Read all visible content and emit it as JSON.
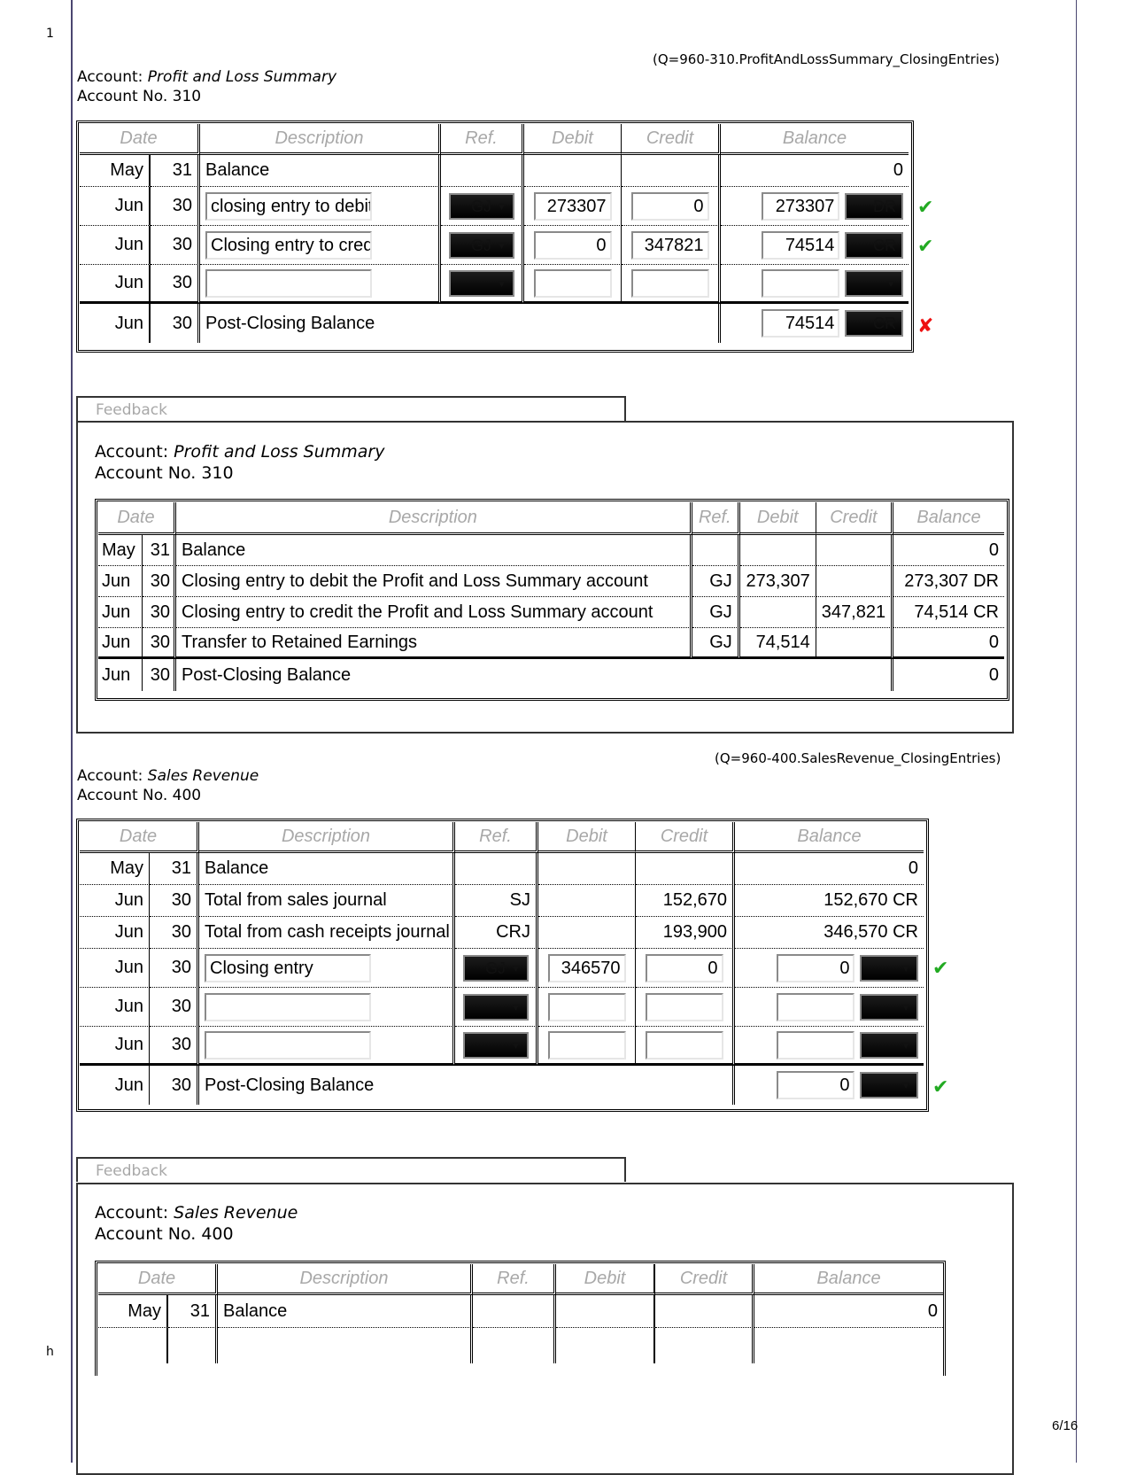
{
  "margin": {
    "line_number": "1",
    "footer_left": "h",
    "page_no": "6/16"
  },
  "pl": {
    "question_id": "(Q=960-310.ProfitAndLossSummary_ClosingEntries)",
    "account_label": "Account: ",
    "account_name": "Profit and Loss Summary",
    "account_no": "Account No. 310",
    "headers": {
      "date": "Date",
      "description": "Description",
      "ref": "Ref.",
      "debit": "Debit",
      "credit": "Credit",
      "balance": "Balance"
    },
    "opening": {
      "month": "May",
      "day": "31",
      "description": "Balance",
      "balance": "0"
    },
    "entries": [
      {
        "month": "Jun",
        "day": "30",
        "description": "closing entry to debit",
        "ref": "GJ",
        "debit": "273307",
        "credit": "0",
        "balance": "273307",
        "side": "DR",
        "result": "correct"
      },
      {
        "month": "Jun",
        "day": "30",
        "description": "Closing entry to credi",
        "ref": "GJ",
        "debit": "0",
        "credit": "347821",
        "balance": "74514",
        "side": "CR",
        "result": "correct"
      },
      {
        "month": "Jun",
        "day": "30",
        "description": "",
        "ref": "",
        "debit": "",
        "credit": "",
        "balance": "",
        "side": "",
        "result": ""
      }
    ],
    "post_closing": {
      "month": "Jun",
      "day": "30",
      "description": "Post-Closing Balance",
      "balance": "74514",
      "side": "CR",
      "result": "incorrect"
    }
  },
  "pl_feedback": {
    "tab_label": "Feedback",
    "account_label": "Account: ",
    "account_name": "Profit and Loss Summary",
    "account_no": "Account No. 310",
    "headers": {
      "date": "Date",
      "description": "Description",
      "ref": "Ref.",
      "debit": "Debit",
      "credit": "Credit",
      "balance": "Balance"
    },
    "rows": [
      {
        "month": "May",
        "day": "31",
        "description": "Balance",
        "ref": "",
        "debit": "",
        "credit": "",
        "balance": "0"
      },
      {
        "month": "Jun",
        "day": "30",
        "description": "Closing entry to debit the Profit and Loss Summary account",
        "ref": "GJ",
        "debit": "273,307",
        "credit": "",
        "balance": "273,307 DR"
      },
      {
        "month": "Jun",
        "day": "30",
        "description": "Closing entry to credit the Profit and Loss Summary account",
        "ref": "GJ",
        "debit": "",
        "credit": "347,821",
        "balance": "74,514 CR"
      },
      {
        "month": "Jun",
        "day": "30",
        "description": "Transfer to Retained Earnings",
        "ref": "GJ",
        "debit": "74,514",
        "credit": "",
        "balance": "0"
      }
    ],
    "post_closing": {
      "month": "Jun",
      "day": "30",
      "description": "Post-Closing Balance",
      "balance": "0"
    }
  },
  "sr": {
    "question_id": "(Q=960-400.SalesRevenue_ClosingEntries)",
    "account_label": "Account: ",
    "account_name": "Sales Revenue",
    "account_no": "Account No. 400",
    "headers": {
      "date": "Date",
      "description": "Description",
      "ref": "Ref.",
      "debit": "Debit",
      "credit": "Credit",
      "balance": "Balance"
    },
    "opening": {
      "month": "May",
      "day": "31",
      "description": "Balance",
      "balance": "0"
    },
    "posted": [
      {
        "month": "Jun",
        "day": "30",
        "description": "Total from sales journal",
        "ref": "SJ",
        "debit": "",
        "credit": "152,670",
        "balance": "152,670 CR"
      },
      {
        "month": "Jun",
        "day": "30",
        "description": "Total from cash receipts journal",
        "ref": "CRJ",
        "debit": "",
        "credit": "193,900",
        "balance": "346,570 CR"
      }
    ],
    "entries": [
      {
        "month": "Jun",
        "day": "30",
        "description": "Closing entry",
        "ref": "GJ",
        "debit": "346570",
        "credit": "0",
        "balance": "0",
        "side": "",
        "result": "correct"
      },
      {
        "month": "Jun",
        "day": "30",
        "description": "",
        "ref": "",
        "debit": "",
        "credit": "",
        "balance": "",
        "side": "",
        "result": ""
      },
      {
        "month": "Jun",
        "day": "30",
        "description": "",
        "ref": "",
        "debit": "",
        "credit": "",
        "balance": "",
        "side": "",
        "result": ""
      }
    ],
    "post_closing": {
      "month": "Jun",
      "day": "30",
      "description": "Post-Closing Balance",
      "balance": "0",
      "side": "",
      "result": "correct"
    }
  },
  "sr_feedback": {
    "tab_label": "Feedback",
    "account_label": "Account: ",
    "account_name": "Sales Revenue",
    "account_no": "Account No. 400",
    "headers": {
      "date": "Date",
      "description": "Description",
      "ref": "Ref.",
      "debit": "Debit",
      "credit": "Credit",
      "balance": "Balance"
    },
    "rows": [
      {
        "month": "May",
        "day": "31",
        "description": "Balance",
        "ref": "",
        "debit": "",
        "credit": "",
        "balance": "0"
      }
    ]
  },
  "icons": {
    "correct": "✔",
    "incorrect": "✘",
    "dropdown": "▼"
  }
}
